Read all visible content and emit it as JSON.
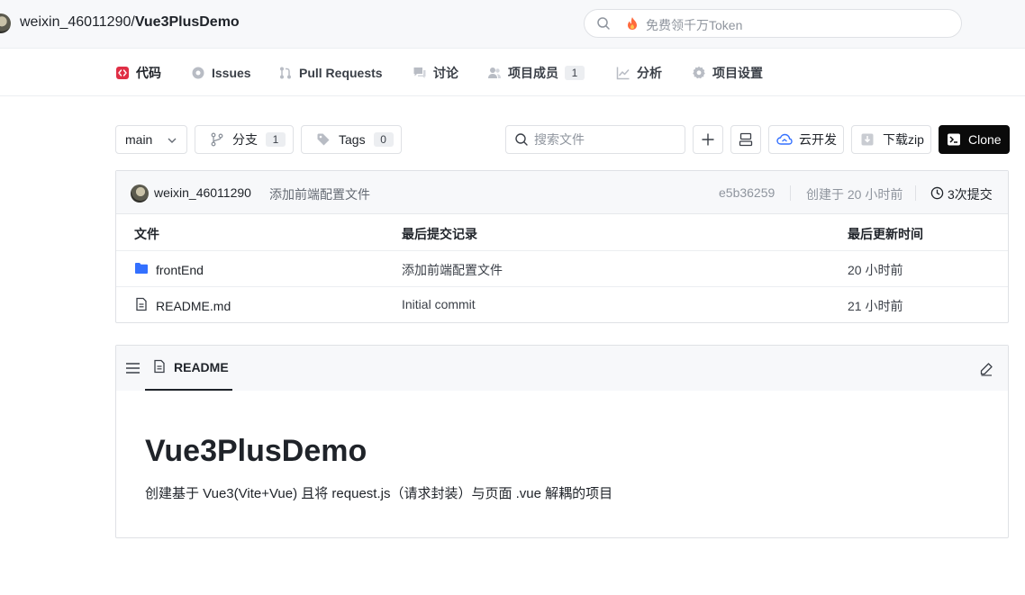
{
  "header": {
    "owner": "weixin_46011290",
    "separator": "/",
    "repo": "Vue3PlusDemo",
    "search_placeholder": "免费领千万Token"
  },
  "nav": {
    "tabs": [
      {
        "label": "代码",
        "icon": "code-icon",
        "active": true
      },
      {
        "label": "Issues",
        "icon": "issues-icon"
      },
      {
        "label": "Pull Requests",
        "icon": "pull-request-icon"
      },
      {
        "label": "讨论",
        "icon": "discussion-icon"
      },
      {
        "label": "项目成员",
        "icon": "members-icon",
        "count": "1"
      },
      {
        "label": "分析",
        "icon": "analytics-icon"
      },
      {
        "label": "项目设置",
        "icon": "settings-icon"
      }
    ]
  },
  "toolbar": {
    "branch": "main",
    "branches_label": "分支",
    "branches_count": "1",
    "tags_label": "Tags",
    "tags_count": "0",
    "file_search_placeholder": "搜索文件",
    "cloud_dev_label": "云开发",
    "download_zip_label": "下载zip",
    "clone_label": "Clone"
  },
  "commit": {
    "author": "weixin_46011290",
    "message": "添加前端配置文件",
    "hash": "e5b36259",
    "created": "创建于 20 小时前",
    "count": "3次提交"
  },
  "files": {
    "headers": [
      "文件",
      "最后提交记录",
      "最后更新时间"
    ],
    "rows": [
      {
        "name": "frontEnd",
        "type": "folder",
        "commit": "添加前端配置文件",
        "time": "20 小时前"
      },
      {
        "name": "README.md",
        "type": "file",
        "commit": "Initial commit",
        "time": "21 小时前"
      }
    ]
  },
  "readme": {
    "tab_label": "README",
    "title": "Vue3PlusDemo",
    "description": "创建基于 Vue3(Vite+Vue) 且将 request.js（请求封装）与页面 .vue 解耦的项目"
  },
  "colors": {
    "accent_code": "#e02e45",
    "folder": "#3370ff",
    "clone_bg": "#0a0a0a"
  }
}
